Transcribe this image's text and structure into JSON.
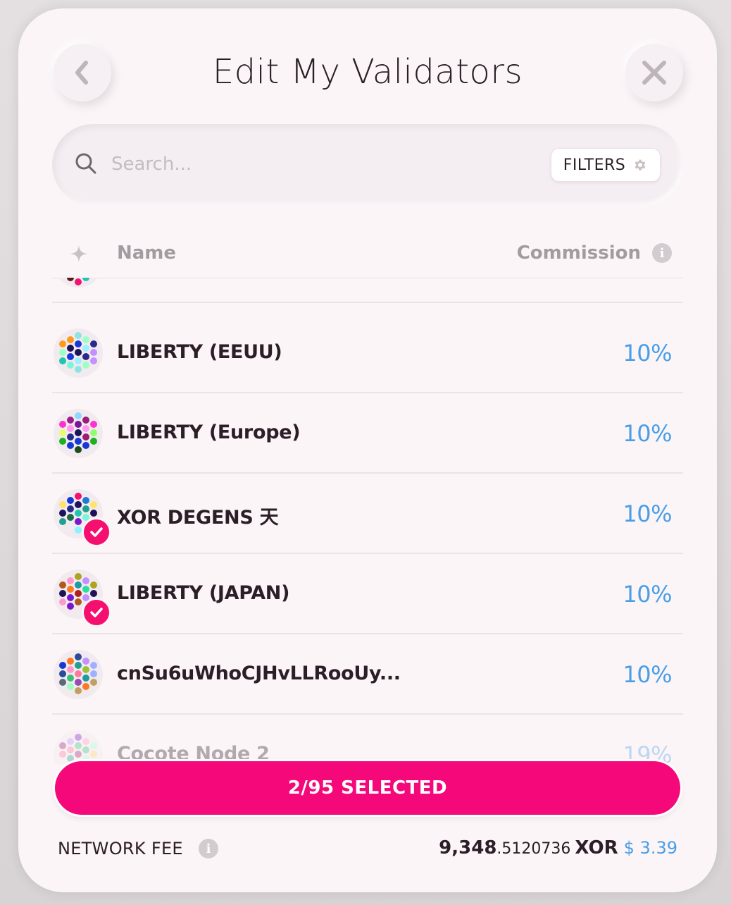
{
  "header": {
    "title": "Edit My Validators"
  },
  "search": {
    "placeholder": "Search...",
    "filters_label": "FILTERS"
  },
  "columns": {
    "name": "Name",
    "commission": "Commission"
  },
  "validators": [
    {
      "name": "",
      "commission": "",
      "selected": false,
      "partial": true
    },
    {
      "name": "LIBERTY (EEUU)",
      "commission": "10%",
      "selected": false
    },
    {
      "name": "LIBERTY (Europe)",
      "commission": "10%",
      "selected": false
    },
    {
      "name": "XOR DEGENS 天",
      "commission": "10%",
      "selected": true
    },
    {
      "name": "LIBERTY (JAPAN)",
      "commission": "10%",
      "selected": true
    },
    {
      "name": "cnSu6uWhoCJHvLLRooUy...",
      "commission": "10%",
      "selected": false
    },
    {
      "name": "Cocote Node 2",
      "commission": "19%",
      "selected": false,
      "faded": true
    }
  ],
  "footer": {
    "selected_label": "2/95 SELECTED",
    "network_fee_label": "NETWORK FEE",
    "fee_int": "9,348",
    "fee_dec": ".5120736",
    "fee_symbol": "XOR",
    "fee_usd": "$ 3.39"
  },
  "colors": {
    "accent": "#f5097a",
    "commission": "#4a9ee6",
    "text": "#2b1e26"
  }
}
